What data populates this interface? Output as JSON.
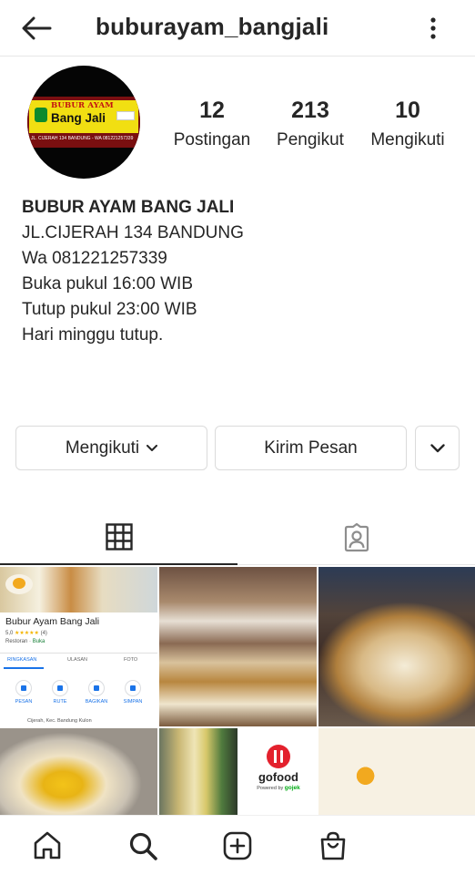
{
  "header": {
    "username": "buburayam_bangjali",
    "back_icon": "arrow-left-icon",
    "more_icon": "more-vertical-icon"
  },
  "avatar": {
    "sign_title": "Bubur Ayam",
    "sign_name": "Bang Jali",
    "sign_address": "JL. CIJERAH 134 BANDUNG - WA 081221257339"
  },
  "stats": [
    {
      "value": "12",
      "label": "Postingan"
    },
    {
      "value": "213",
      "label": "Pengikut"
    },
    {
      "value": "10",
      "label": "Mengikuti"
    }
  ],
  "bio": {
    "name": "BUBUR AYAM BANG JALI",
    "lines": [
      "JL.CIJERAH 134 BANDUNG",
      "Wa 081221257339",
      "Buka pukul 16:00 WIB",
      "Tutup pukul 23:00 WIB",
      "Hari minggu tutup."
    ]
  },
  "actions": {
    "follow_label": "Mengikuti",
    "message_label": "Kirim Pesan"
  },
  "tabs": [
    {
      "icon": "grid-icon",
      "active": true
    },
    {
      "icon": "tagged-person-icon",
      "active": false
    }
  ],
  "posts": {
    "maps_card": {
      "title": "Bubur Ayam Bang Jali",
      "rating": "5,0",
      "stars": "★★★★★",
      "review_count": "(4)",
      "category": "Restoran",
      "status": "Buka",
      "tab_labels": [
        "RINGKASAN",
        "ULASAN",
        "FOTO"
      ],
      "action_labels": [
        "PESAN",
        "RUTE",
        "BAGIKAN",
        "SIMPAN"
      ],
      "address": "Cijerah, Kec. Bandung Kulon"
    },
    "gofood_card": {
      "name": "gofood",
      "powered_by": "Powered by",
      "brand": "gojek"
    }
  },
  "bottom_nav": [
    {
      "icon": "home-icon"
    },
    {
      "icon": "search-icon"
    },
    {
      "icon": "add-post-icon"
    },
    {
      "icon": "shop-bag-icon"
    }
  ],
  "colors": {
    "text": "#262626",
    "border": "#dbdbdb",
    "gofood_red": "#e3212d",
    "gojek_green": "#00aa13",
    "maps_blue": "#1a73e8"
  }
}
